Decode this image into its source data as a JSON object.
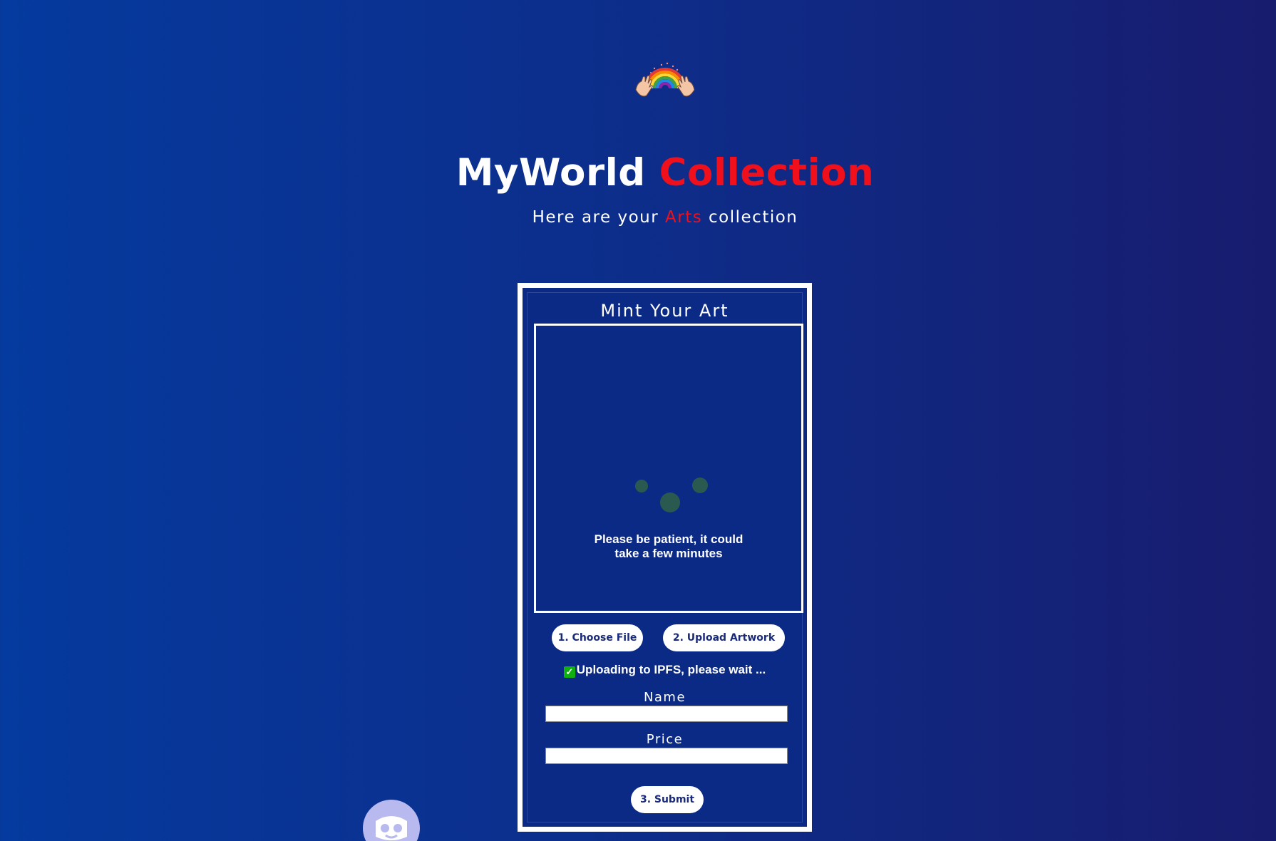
{
  "hero": {
    "icon": "rainbow-hands-icon",
    "title_main": "MyWorld",
    "title_accent": "Collection",
    "subtitle_before": "Here are your",
    "subtitle_accent": "Arts",
    "subtitle_after": "collection",
    "accent_color": "#f0101c"
  },
  "mint_card": {
    "title": "Mint Your Art",
    "loading_text": "Please be patient, it could take a few minutes",
    "choose_file_label": "1. Choose File",
    "upload_label": "2. Upload Artwork",
    "status_icon": "check-mark-icon",
    "status_text": "Uploading to IPFS, please wait ...",
    "name_label": "Name",
    "name_value": "",
    "price_label": "Price",
    "price_value": "",
    "submit_label": "3. Submit"
  },
  "colors": {
    "background_start": "#053a9e",
    "background_end": "#181c6e",
    "card_background": "#0a2a86",
    "button_text": "#1a2a7a",
    "loader_dot": "#2a5a4f",
    "status_check": "#10b010"
  },
  "footer": {
    "avatar_icon": "bot-avatar-icon"
  }
}
